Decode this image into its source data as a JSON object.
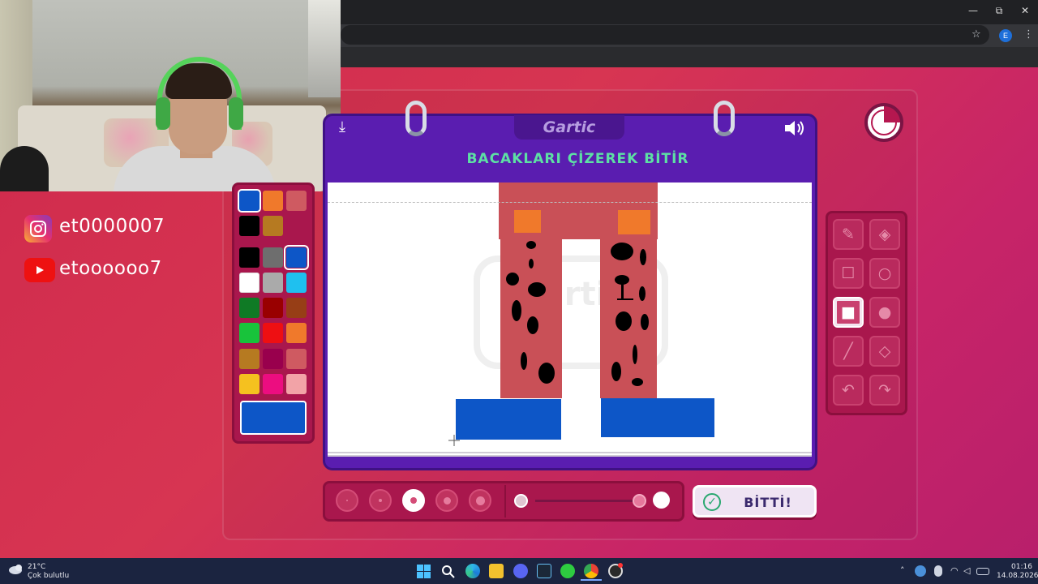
{
  "browser": {
    "minimize_icon": "—",
    "restore_icon": "⧉",
    "close_icon": "✕",
    "star_icon": "☆",
    "profile_letter": "E",
    "menu_icon": "⋮"
  },
  "stream_overlay": {
    "instagram_handle": "et0000007",
    "youtube_handle": "etoooooo7"
  },
  "game": {
    "logo": "Gartic",
    "task_title": "BACAKLARI ÇİZEREK BİTİR",
    "sound_icon": "🔊",
    "download_icon": "⤓",
    "done_button": "BİTTİ!",
    "palette": {
      "colors": [
        [
          "#0d56c7",
          "#f0792b",
          "#cf5a61"
        ],
        [
          "#000000",
          "#b67a21"
        ],
        [
          "#000000",
          "#6e6e6e",
          "#0d56c7"
        ],
        [
          "#ffffff",
          "#aaaaaa",
          "#1fc0ef"
        ],
        [
          "#0f7a25",
          "#990000",
          "#973e16"
        ],
        [
          "#18c33b",
          "#ee0f12",
          "#f0792b"
        ],
        [
          "#b67a21",
          "#99004d",
          "#cf5a61"
        ],
        [
          "#f5c11f",
          "#ec0d80",
          "#f2a3a7"
        ]
      ],
      "selected_color": "#0d56c7",
      "current_color": "#0d56c7"
    },
    "tools": [
      "pencil-icon",
      "eraser-icon",
      "rectangle-outline-icon",
      "ellipse-outline-icon",
      "rectangle-filled-icon",
      "ellipse-filled-icon",
      "line-icon",
      "fill-bucket-icon",
      "undo-icon",
      "redo-icon"
    ],
    "active_tool": "rectangle-filled-icon",
    "brush_sizes": [
      1,
      2,
      3,
      4,
      5
    ],
    "active_brush_size": 3,
    "opacity_level": 1.0,
    "timer_remaining_fraction": 0.75
  },
  "taskbar": {
    "weather_temp": "21°C",
    "weather_desc": "Çok bulutlu",
    "time": "01:16",
    "date": "14.08.2026"
  }
}
